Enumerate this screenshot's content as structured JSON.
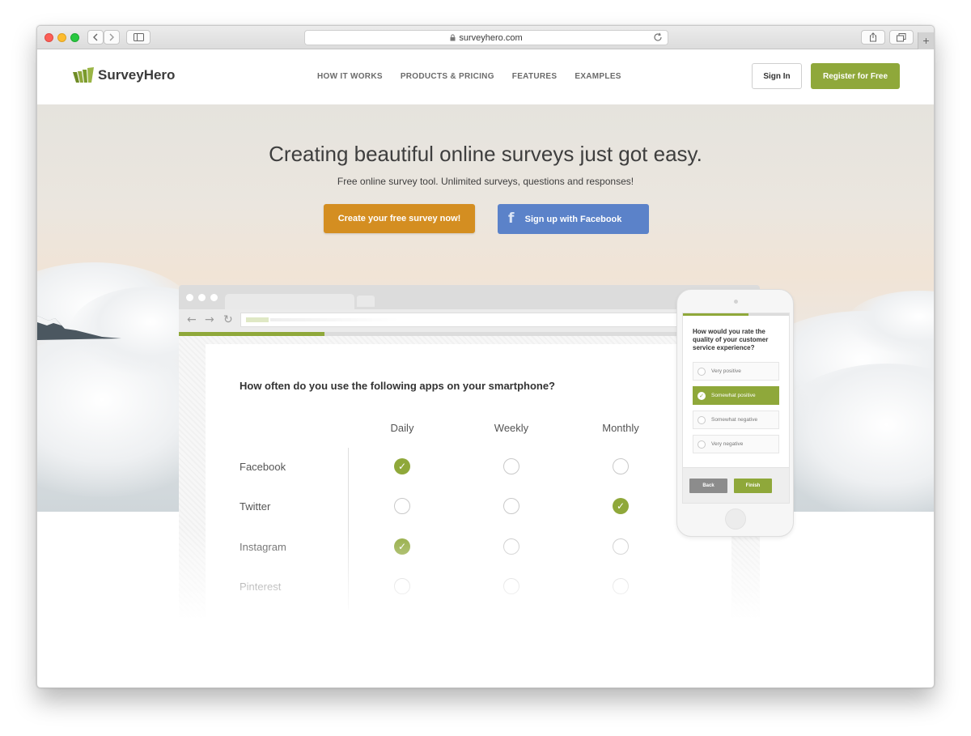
{
  "browser": {
    "url": "surveyhero.com"
  },
  "header": {
    "logo_text": "SurveyHero",
    "nav": [
      "HOW IT WORKS",
      "PRODUCTS & PRICING",
      "FEATURES",
      "EXAMPLES"
    ],
    "signin_label": "Sign In",
    "register_label": "Register for Free"
  },
  "hero": {
    "title": "Creating beautiful online surveys just got easy.",
    "subtitle": "Free online survey tool. Unlimited surveys, questions and responses!",
    "cta_primary": "Create your free survey now!",
    "cta_facebook": "Sign up with Facebook"
  },
  "survey": {
    "question": "How often do you use the following apps on your smartphone?",
    "columns": [
      "Daily",
      "Weekly",
      "Monthly"
    ],
    "rows": [
      {
        "label": "Facebook",
        "selected": "Daily"
      },
      {
        "label": "Twitter",
        "selected": "Monthly"
      },
      {
        "label": "Instagram",
        "selected": "Daily"
      },
      {
        "label": "Pinterest",
        "selected": null
      }
    ],
    "progress": 0.25
  },
  "phone": {
    "question": "How would you rate the quality of your customer service experience?",
    "options": [
      "Very positive",
      "Somewhat positive",
      "Somewhat negative",
      "Very negative"
    ],
    "selected": "Somewhat positive",
    "back_label": "Back",
    "finish_label": "Finish",
    "progress": 0.62
  },
  "colors": {
    "brand_green": "#8fa83a",
    "cta_orange": "#d48e21",
    "facebook_blue": "#5b82c9"
  }
}
